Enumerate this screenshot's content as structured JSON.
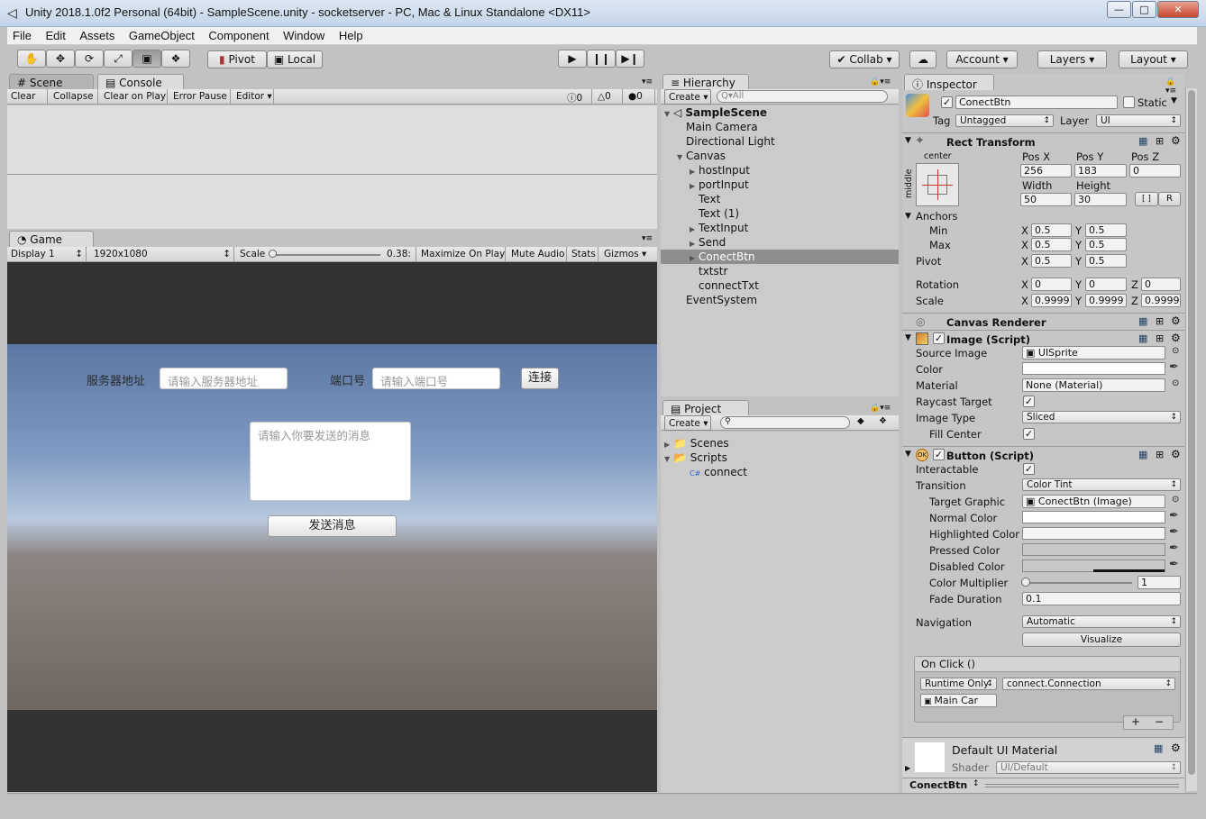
{
  "window": {
    "title": "Unity 2018.1.0f2 Personal (64bit) - SampleScene.unity - socketserver - PC, Mac & Linux Standalone <DX11>",
    "minimize": "—",
    "maximize": "□",
    "close": "✕"
  },
  "menu": [
    "File",
    "Edit",
    "Assets",
    "GameObject",
    "Component",
    "Window",
    "Help"
  ],
  "toolbar": {
    "pivot": "Pivot",
    "local": "Local",
    "collab": "Collab",
    "account": "Account",
    "layers": "Layers",
    "layout": "Layout"
  },
  "scene_tabs": {
    "scene": "Scene",
    "console": "Console"
  },
  "console_toolbar": [
    "Clear",
    "Collapse",
    "Clear on Play",
    "Error Pause",
    "Editor"
  ],
  "console_counts": {
    "info": "0",
    "warn": "0",
    "error": "0"
  },
  "game": {
    "tab": "Game",
    "display": "Display 1",
    "resolution": "1920x1080",
    "scale_label": "Scale",
    "scale_value": "0.38:",
    "scale_fraction": 0,
    "options": [
      "Maximize On Play",
      "Mute Audio",
      "Stats",
      "Gizmos"
    ],
    "ui": {
      "server_label": "服务器地址",
      "server_placeholder": "请输入服务器地址",
      "port_label": "端口号",
      "port_placeholder": "请输入端口号",
      "connect_button": "连接",
      "message_placeholder": "请输入你要发送的消息",
      "send_button": "发送消息"
    }
  },
  "hierarchy": {
    "tab": "Hierarchy",
    "create": "Create",
    "search_placeholder": "Q▾All",
    "scene": "SampleScene",
    "items": [
      {
        "label": "Main Camera",
        "depth": 1,
        "arrow": false
      },
      {
        "label": "Directional Light",
        "depth": 1,
        "arrow": false
      },
      {
        "label": "Canvas",
        "depth": 1,
        "arrow": true,
        "expanded": true
      },
      {
        "label": "hostInput",
        "depth": 2,
        "arrow": true
      },
      {
        "label": "portInput",
        "depth": 2,
        "arrow": true
      },
      {
        "label": "Text",
        "depth": 2,
        "arrow": false
      },
      {
        "label": "Text (1)",
        "depth": 2,
        "arrow": false
      },
      {
        "label": "TextInput",
        "depth": 2,
        "arrow": true
      },
      {
        "label": "Send",
        "depth": 2,
        "arrow": true
      },
      {
        "label": "ConectBtn",
        "depth": 2,
        "arrow": true,
        "selected": true
      },
      {
        "label": "txtstr",
        "depth": 2,
        "arrow": false
      },
      {
        "label": "connectTxt",
        "depth": 2,
        "arrow": false
      },
      {
        "label": "EventSystem",
        "depth": 1,
        "arrow": false
      }
    ]
  },
  "project": {
    "tab": "Project",
    "create": "Create",
    "items": [
      "Scenes",
      "Scripts",
      "connect"
    ]
  },
  "inspector": {
    "tab": "Inspector",
    "object_name": "ConectBtn",
    "static": "Static",
    "tag_label": "Tag",
    "tag": "Untagged",
    "layer_label": "Layer",
    "layer": "UI",
    "rect_transform": {
      "title": "Rect Transform",
      "anchor_preset_top": "center",
      "anchor_preset_side": "middle",
      "pos_x_label": "Pos X",
      "pos_y_label": "Pos Y",
      "pos_z_label": "Pos Z",
      "pos_x": "256",
      "pos_y": "183",
      "pos_z": "0",
      "width_label": "Width",
      "height_label": "Height",
      "width": "50",
      "height": "30",
      "r_button": "R",
      "anchors": "Anchors",
      "min": "Min",
      "max": "Max",
      "pivot": "Pivot",
      "x": "X",
      "y": "Y",
      "z": "Z",
      "min_x": "0.5",
      "min_y": "0.5",
      "max_x": "0.5",
      "max_y": "0.5",
      "pivot_x": "0.5",
      "pivot_y": "0.5",
      "rotation": "Rotation",
      "rot_x": "0",
      "rot_y": "0",
      "rot_z": "0",
      "scale": "Scale",
      "scale_x": "0.9999",
      "scale_y": "0.9999",
      "scale_z": "0.9999"
    },
    "canvas_renderer": {
      "title": "Canvas Renderer"
    },
    "image": {
      "title": "Image (Script)",
      "source_image_label": "Source Image",
      "source_image": "UISprite",
      "color_label": "Color",
      "material_label": "Material",
      "material": "None (Material)",
      "raycast_label": "Raycast Target",
      "image_type_label": "Image Type",
      "image_type": "Sliced",
      "fill_center_label": "Fill Center"
    },
    "button": {
      "title": "Button (Script)",
      "interactable_label": "Interactable",
      "transition_label": "Transition",
      "transition": "Color Tint",
      "target_graphic_label": "Target Graphic",
      "target_graphic": "ConectBtn (Image)",
      "normal_color_label": "Normal Color",
      "highlighted_color_label": "Highlighted Color",
      "pressed_color_label": "Pressed Color",
      "disabled_color_label": "Disabled Color",
      "multiplier_label": "Color Multiplier",
      "multiplier": "1",
      "fade_label": "Fade Duration",
      "fade": "0.1",
      "navigation_label": "Navigation",
      "navigation": "Automatic",
      "visualize": "Visualize",
      "onclick_label": "On Click ()",
      "runtime": "Runtime Only",
      "function": "connect.Connection",
      "target_object": "Main Car",
      "add": "+",
      "remove": "−"
    },
    "material": {
      "name": "Default UI Material",
      "shader_label": "Shader",
      "shader": "UI/Default"
    },
    "footer": "ConectBtn"
  }
}
